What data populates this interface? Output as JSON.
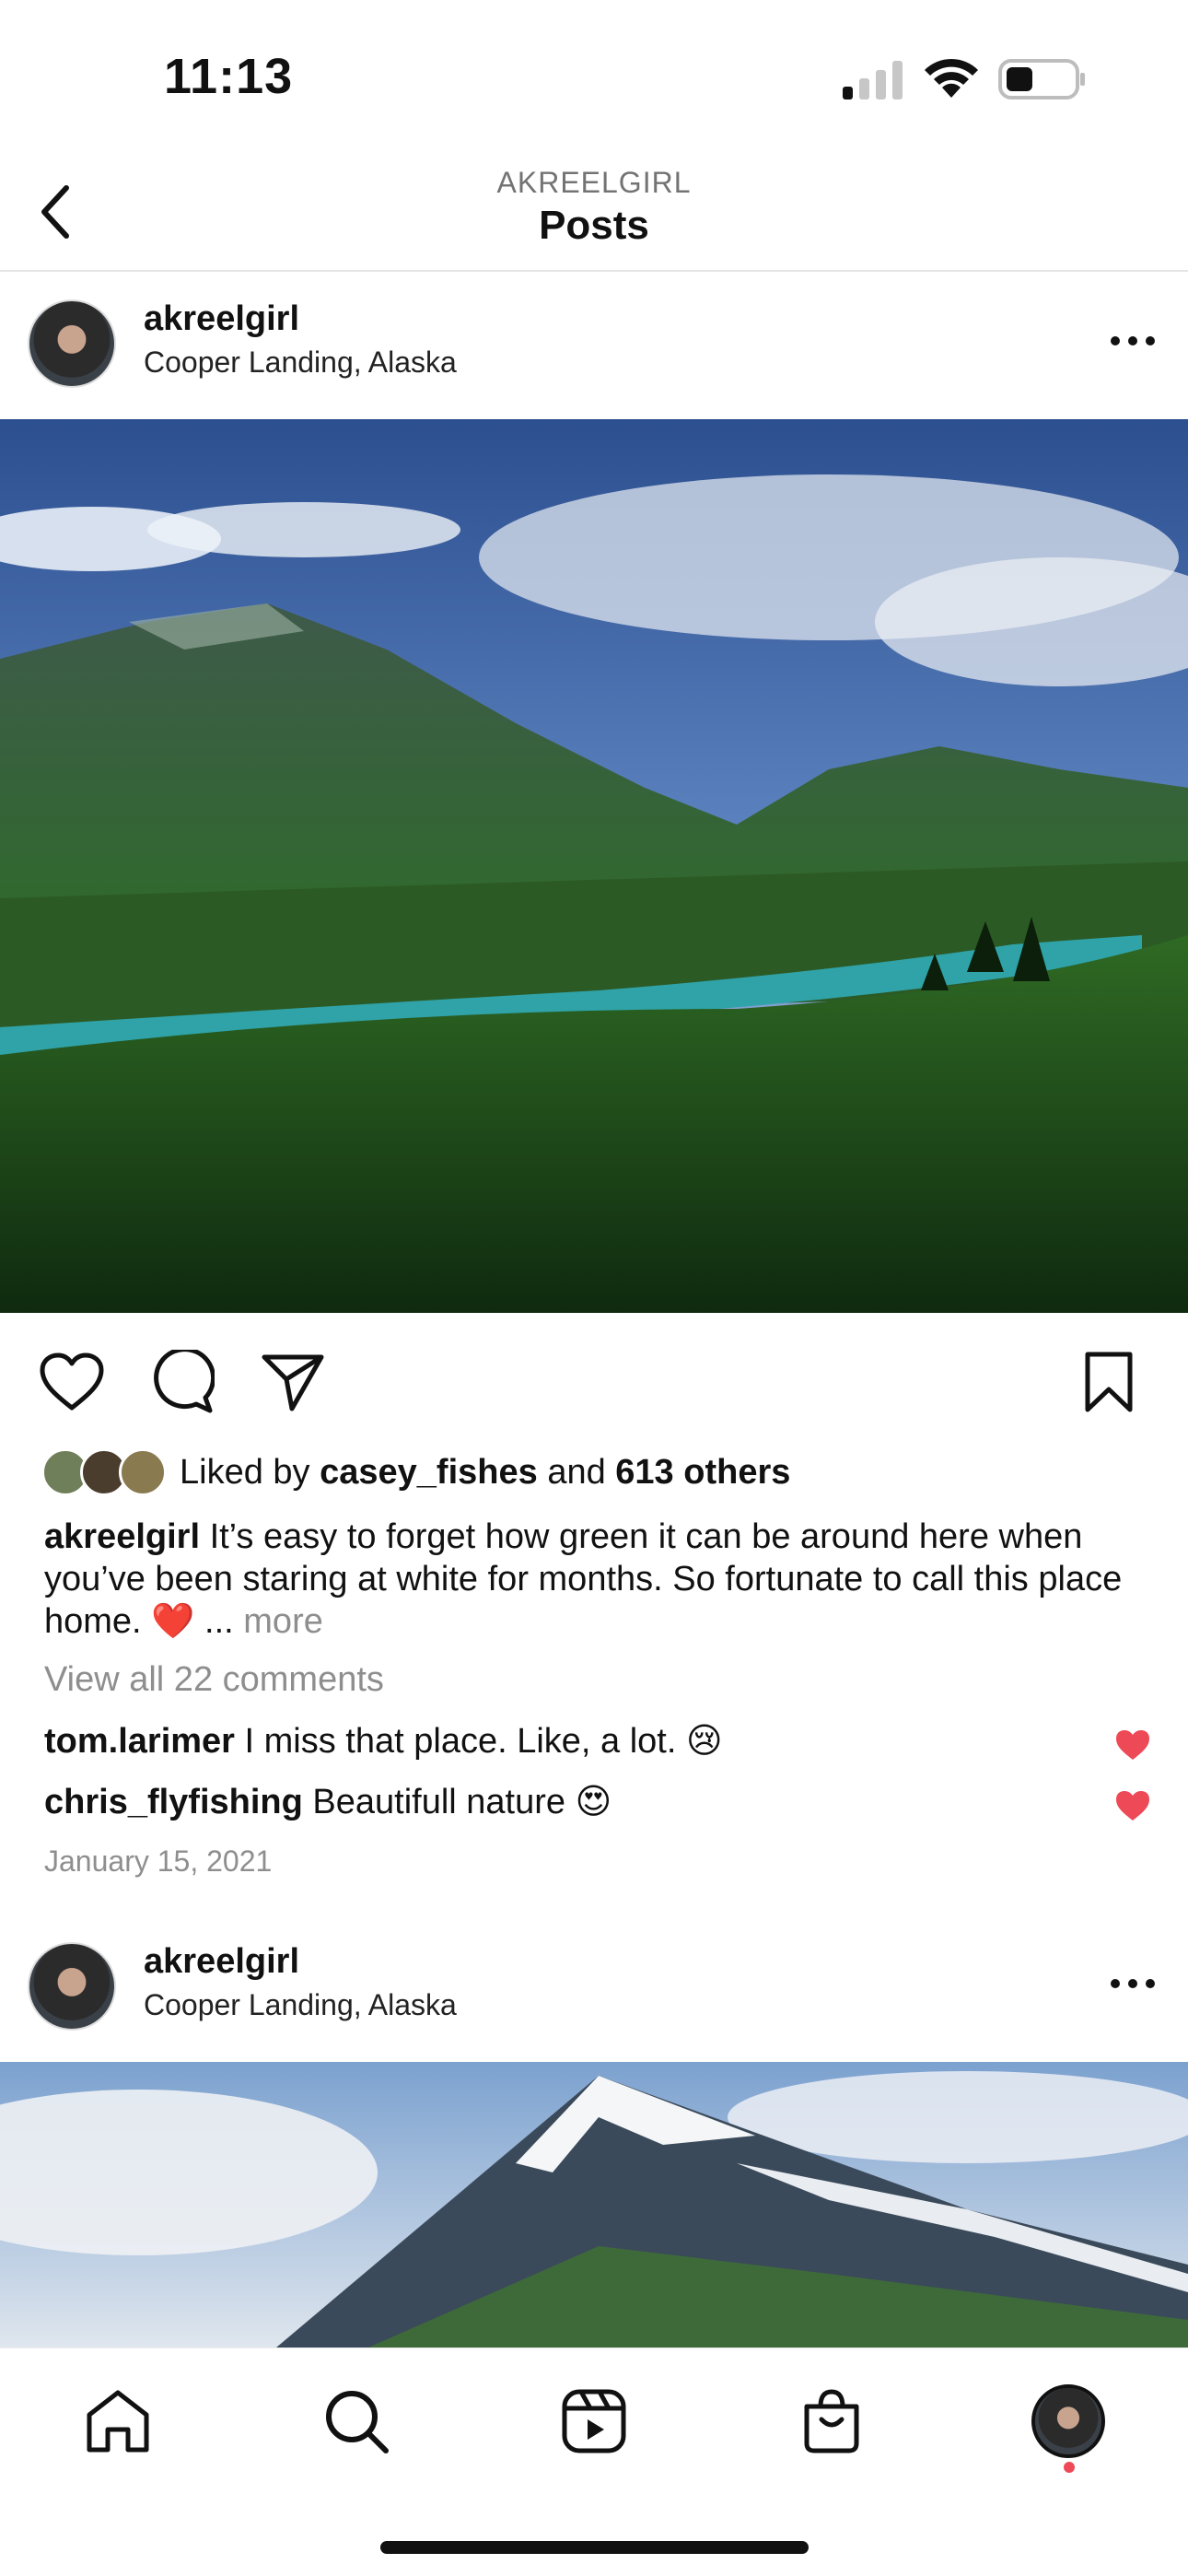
{
  "status_bar": {
    "time": "11:13"
  },
  "header": {
    "username": "AKREELGIRL",
    "title": "Posts"
  },
  "posts": [
    {
      "username": "akreelgirl",
      "location": "Cooper Landing, Alaska",
      "liked_by_prefix": "Liked by",
      "liked_by_user": "casey_fishes",
      "liked_by_and": "and",
      "liked_by_others": "613 others",
      "caption_user": "akreelgirl",
      "caption_text": "It’s easy to forget how green it can be around here when you’ve been staring at white for months. So fortunate to call this place home. ❤️ ...",
      "caption_more": "more",
      "view_comments": "View all 22 comments",
      "comments": [
        {
          "user": "tom.larimer",
          "text": "I miss that place. Like, a lot. 😢"
        },
        {
          "user": "chris_flyfishing",
          "text": "Beautifull nature 😍"
        }
      ],
      "date": "January 15, 2021"
    },
    {
      "username": "akreelgirl",
      "location": "Cooper Landing, Alaska"
    }
  ],
  "colors": {
    "heart_red": "#ed4956",
    "muted": "#8e8e8e"
  },
  "icons": [
    "back-icon",
    "more-icon",
    "heart-icon",
    "comment-icon",
    "share-icon",
    "bookmark-icon",
    "home-icon",
    "search-icon",
    "reels-icon",
    "shop-icon"
  ]
}
